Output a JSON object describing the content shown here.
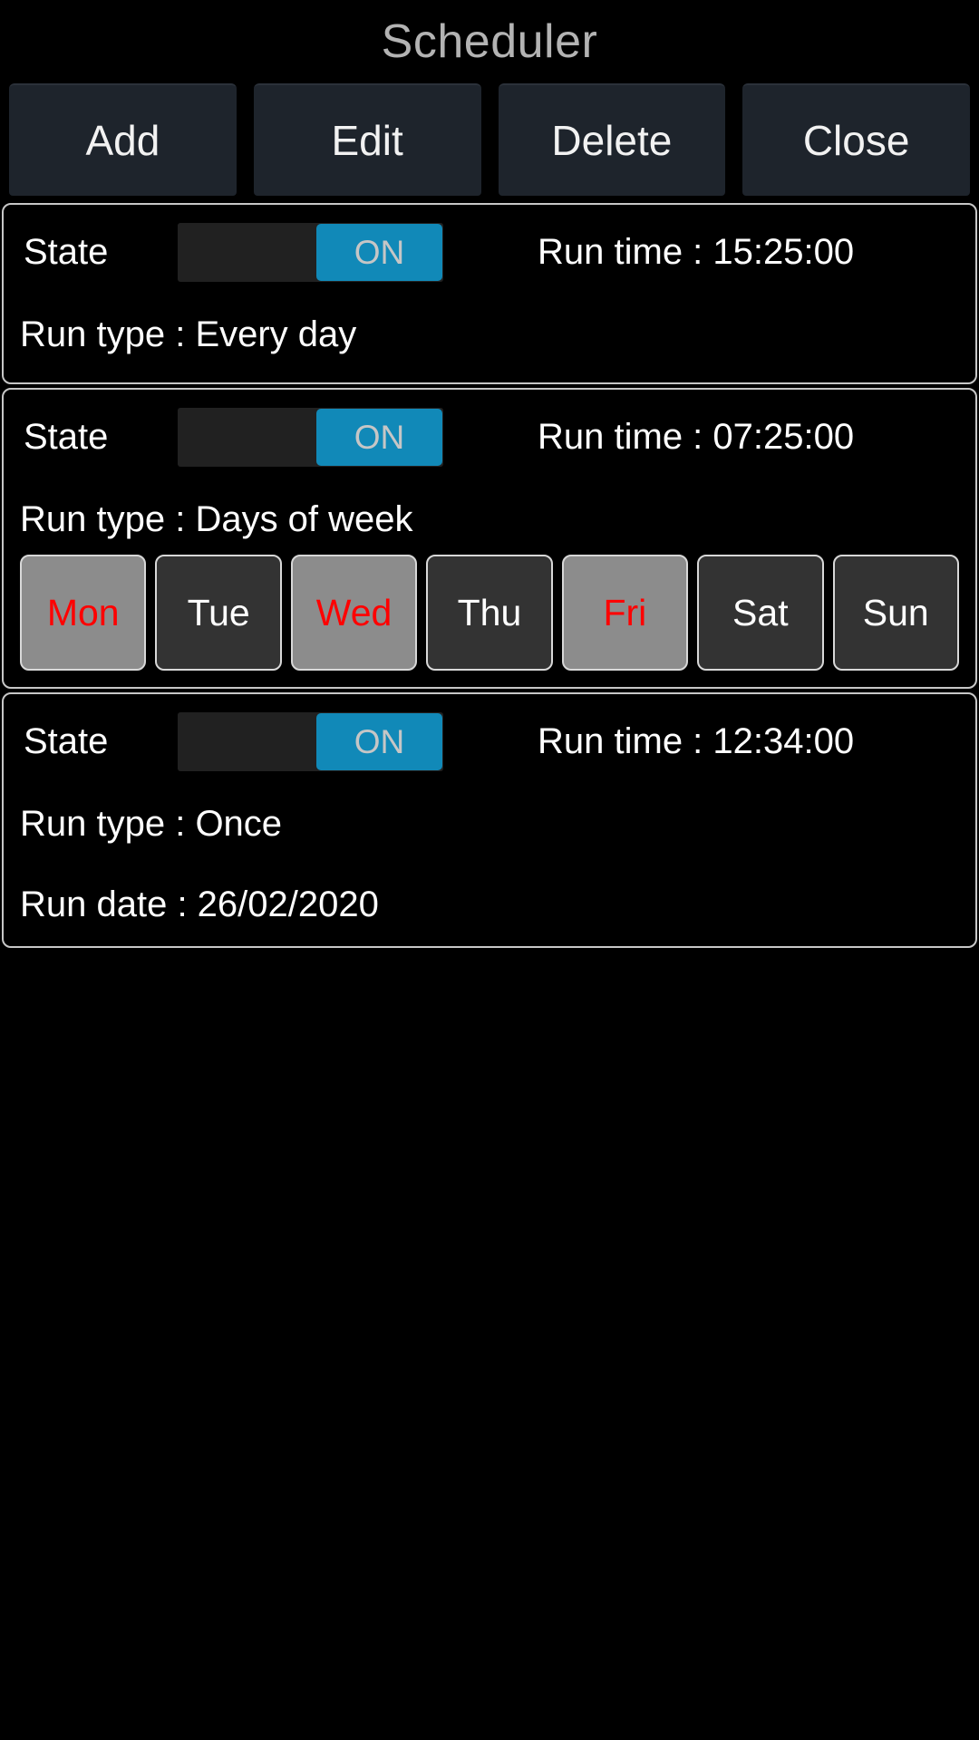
{
  "header": {
    "title": "Scheduler"
  },
  "toolbar": {
    "buttons": [
      {
        "label": "Add",
        "name": "add-button"
      },
      {
        "label": "Edit",
        "name": "edit-button"
      },
      {
        "label": "Delete",
        "name": "delete-button"
      },
      {
        "label": "Close",
        "name": "close-button"
      }
    ]
  },
  "labels": {
    "state": "State",
    "run_time_prefix": "Run time : ",
    "run_type_prefix": "Run type : ",
    "run_date_prefix": "Run date : "
  },
  "colors": {
    "accent_blue": "#1189b8",
    "day_selected_bg": "#8c8c8c",
    "day_selected_text": "#ff0000",
    "day_unselected_bg": "#333333",
    "day_unselected_text": "#ffffff",
    "card_border": "#c7c7c7",
    "button_bg": "#1e242c",
    "title_text": "#b3b3b3",
    "background": "#000000"
  },
  "schedules": [
    {
      "state_label": "State",
      "toggle_value": "ON",
      "toggle_on": true,
      "run_time": "Run time : 15:25:00",
      "run_type": "Run type : Every day",
      "has_days": false,
      "has_run_date": false
    },
    {
      "state_label": "State",
      "toggle_value": "ON",
      "toggle_on": true,
      "run_time": "Run time : 07:25:00",
      "run_type": "Run type : Days of week",
      "has_days": true,
      "has_run_date": false,
      "days": [
        {
          "label": "Mon",
          "selected": true
        },
        {
          "label": "Tue",
          "selected": false
        },
        {
          "label": "Wed",
          "selected": true
        },
        {
          "label": "Thu",
          "selected": false
        },
        {
          "label": "Fri",
          "selected": true
        },
        {
          "label": "Sat",
          "selected": false
        },
        {
          "label": "Sun",
          "selected": false
        }
      ]
    },
    {
      "state_label": "State",
      "toggle_value": "ON",
      "toggle_on": true,
      "run_time": "Run time : 12:34:00",
      "run_type": "Run type : Once",
      "has_days": false,
      "has_run_date": true,
      "run_date": "Run date : 26/02/2020"
    }
  ]
}
